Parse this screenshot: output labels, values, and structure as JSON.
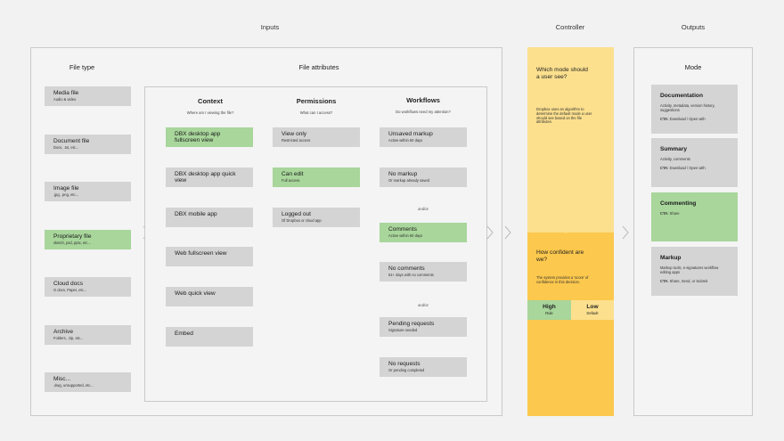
{
  "headers": {
    "inputs": "Inputs",
    "controller": "Controller",
    "outputs": "Outputs"
  },
  "inputs": {
    "file_type": {
      "title": "File type",
      "items": [
        {
          "title": "Media file",
          "sub": "Audio & video",
          "highlight": false
        },
        {
          "title": "Document file",
          "sub": "Docs, .txt, etc...",
          "highlight": false
        },
        {
          "title": "Image file",
          "sub": ".jpg, .png, etc...",
          "highlight": false
        },
        {
          "title": "Proprietary file",
          "sub": "sketch, psd, pptx, etc...",
          "highlight": true
        },
        {
          "title": "Cloud docs",
          "sub": "G docs, Paper, etc...",
          "highlight": false
        },
        {
          "title": "Archive",
          "sub": "Folders, .zip, etc...",
          "highlight": false
        },
        {
          "title": "Misc...",
          "sub": ".dwg, unsupported, etc...",
          "highlight": false
        }
      ]
    },
    "file_attributes": {
      "title": "File attributes",
      "context": {
        "title": "Context",
        "question": "Where am I viewing the file?",
        "items": [
          {
            "title": "DBX desktop app fullscreen view",
            "highlight": true
          },
          {
            "title": "DBX desktop app quick view",
            "highlight": false
          },
          {
            "title": "DBX mobile app",
            "highlight": false
          },
          {
            "title": "Web fullscreen view",
            "highlight": false
          },
          {
            "title": "Web quick view",
            "highlight": false
          },
          {
            "title": "Embed",
            "highlight": false
          }
        ]
      },
      "permissions": {
        "title": "Permissions",
        "question": "What can I access?",
        "items": [
          {
            "title": "View only",
            "sub": "Restricted access",
            "highlight": false
          },
          {
            "title": "Can edit",
            "sub": "Full access",
            "highlight": true
          },
          {
            "title": "Logged out",
            "sub": "Of Dropbox or cloud app",
            "highlight": false
          }
        ]
      },
      "workflows": {
        "title": "Workflows",
        "question": "Do workflows need my attention?",
        "andor": "and/or",
        "items": [
          {
            "title": "Unsaved markup",
            "sub": "Active within 60 days",
            "highlight": false
          },
          {
            "title": "No markup",
            "sub": "Or markup already saved",
            "highlight": false
          },
          {
            "title": "Comments",
            "sub": "Active within 60 days",
            "highlight": true
          },
          {
            "title": "No comments",
            "sub": "61+ days with no comments",
            "highlight": false
          },
          {
            "title": "Pending requests",
            "sub": "Signature needed",
            "highlight": false
          },
          {
            "title": "No requests",
            "sub": "Or pending completed",
            "highlight": false
          }
        ]
      }
    }
  },
  "controller": {
    "question1": "Which mode should a user see?",
    "desc1": "Dropbox uses an algorithm to determine the default mode a user should see based on the file attributes.",
    "question2": "How confident are we?",
    "desc2": "The system provides a 'score' of confidence in this decision.",
    "high": {
      "title": "High",
      "sub": "Rule"
    },
    "low": {
      "title": "Low",
      "sub": "Default"
    }
  },
  "outputs": {
    "title": "Mode",
    "items": [
      {
        "title": "Documentation",
        "desc": "Activity, metadata, version history, suggestions",
        "cta_label": "CTA:",
        "cta": "Download / Open with",
        "highlight": false
      },
      {
        "title": "Summary",
        "desc": "Activity, comments",
        "cta_label": "CTA:",
        "cta": "Download / Open with",
        "highlight": false
      },
      {
        "title": "Commenting",
        "desc": "",
        "cta_label": "CTA:",
        "cta": "Share",
        "highlight": true
      },
      {
        "title": "Markup",
        "desc": "Markup tools, e-signatures workflow editing apps",
        "cta_label": "CTA:",
        "cta": "Share, Send, or Submit",
        "highlight": false
      }
    ]
  },
  "colors": {
    "green": "#a8d69b",
    "gray": "#d4d4d4",
    "yellow_light": "#fce08e",
    "yellow": "#fcc84d"
  }
}
